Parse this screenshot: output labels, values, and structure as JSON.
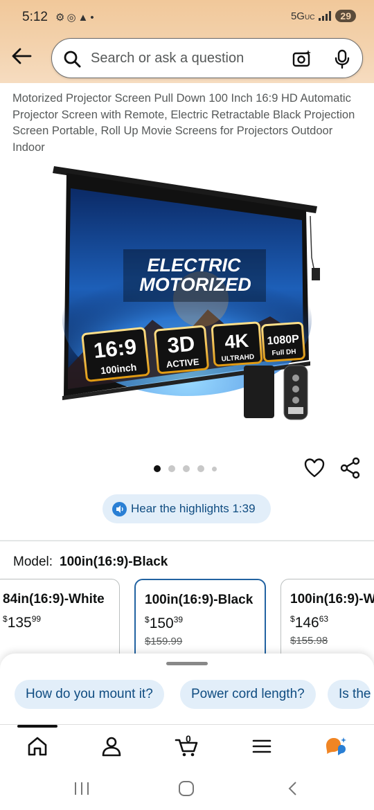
{
  "status_bar": {
    "time": "5:12",
    "network": "5G",
    "network_sub": "UC",
    "battery": "29"
  },
  "search": {
    "placeholder": "Search or ask a question"
  },
  "product": {
    "title": "Motorized Projector Screen Pull Down 100 Inch 16:9 HD Automatic Projector Screen with Remote, Electric Retractable Black Projection Screen Portable, Roll Up Movie Screens for Projectors Outdoor Indoor",
    "image_text": {
      "headline_1": "ELECTRIC",
      "headline_2": "MOTORIZED",
      "badges": [
        {
          "big": "16:9",
          "small": "100inch"
        },
        {
          "big": "3D",
          "small": "ACTIVE"
        },
        {
          "big": "4K",
          "small": "ULTRAHD"
        },
        {
          "big": "1080P",
          "small": "Full DH"
        }
      ]
    },
    "image_carousel": {
      "count": 5,
      "active_index": 0
    }
  },
  "highlights": {
    "label": "Hear the highlights 1:39"
  },
  "model": {
    "label": "Model:",
    "value": "100in(16:9)-Black"
  },
  "variants": [
    {
      "name": "84in(16:9)-White",
      "price_whole": "135",
      "price_fraction": "99",
      "old_price": ""
    },
    {
      "name": "100in(16:9)-Black",
      "price_whole": "150",
      "price_fraction": "39",
      "old_price": "$159.99",
      "selected": true
    },
    {
      "name": "100in(16:9)-W",
      "price_whole": "146",
      "price_fraction": "63",
      "old_price": "$155.98"
    }
  ],
  "currency": "$",
  "questions": [
    "How do you mount it?",
    "Power cord length?",
    "Is the"
  ],
  "bottom_nav": {
    "cart_count": "0",
    "items": [
      "home-icon",
      "account-icon",
      "cart-icon",
      "menu-icon",
      "rufus-icon"
    ]
  },
  "colors": {
    "header_gradient": "#f1c89a",
    "link_blue": "#0f4c81",
    "selected_border": "#2162a1",
    "chip_bg": "#e2eef9"
  }
}
